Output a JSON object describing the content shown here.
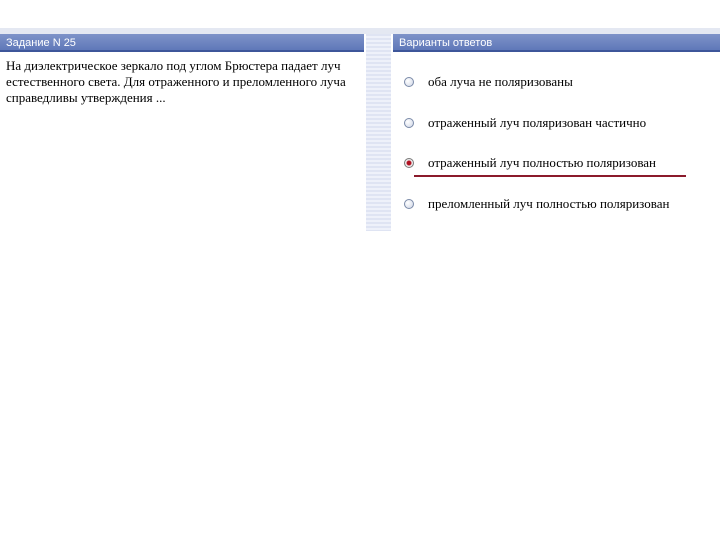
{
  "task": {
    "header": "Задание N 25",
    "question": "На диэлектрическое зеркало под углом Брюстера падает луч естественного света. Для отраженного и преломленного луча справедливы утверждения ..."
  },
  "answers": {
    "header": "Варианты ответов",
    "selected_index": 2,
    "options": [
      {
        "label": "оба луча не поляризованы",
        "checked": false
      },
      {
        "label": "отраженный луч поляризован частично",
        "checked": false
      },
      {
        "label": "отраженный луч полностью поляризован",
        "checked": true
      },
      {
        "label": "преломленный луч полностью поляризован",
        "checked": false
      }
    ]
  },
  "colors": {
    "header_bg": "#6b82c0",
    "selected_mark": "#b01020",
    "underline": "#8b1a2b"
  }
}
